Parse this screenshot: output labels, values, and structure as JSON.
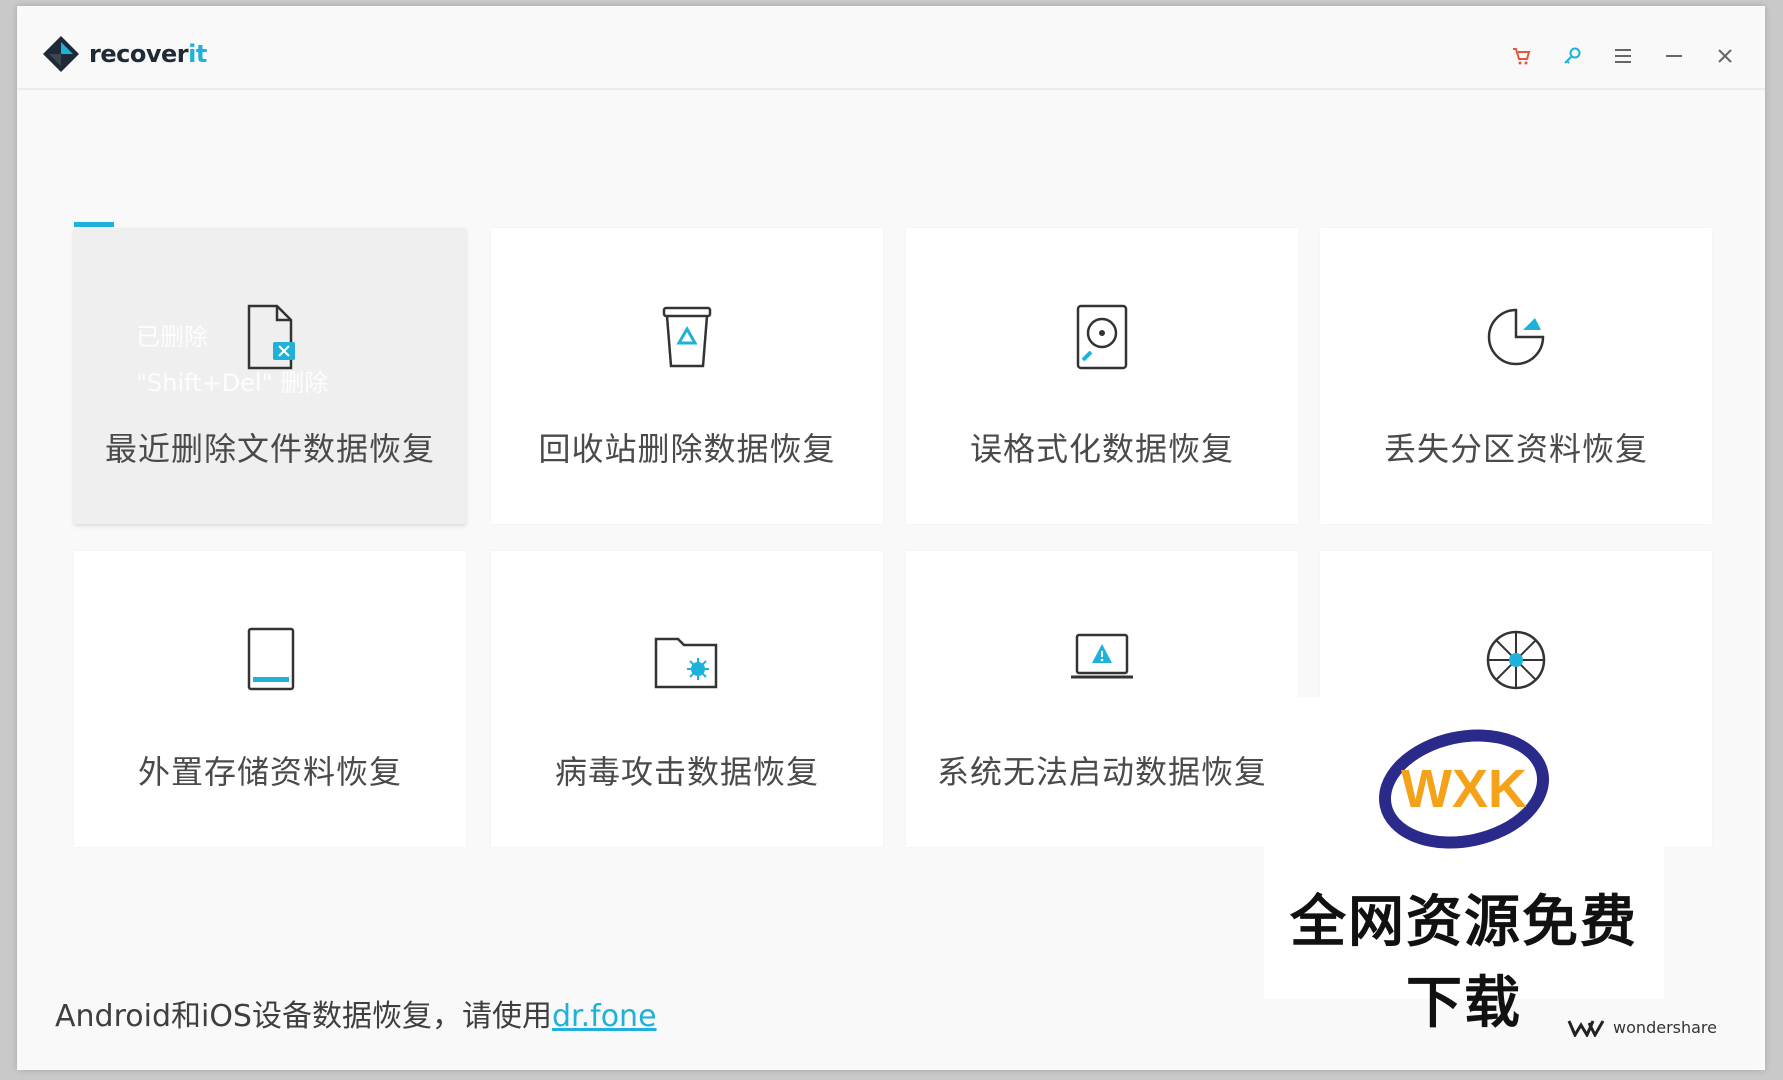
{
  "app": {
    "brand_main": "recover",
    "brand_accent": "it"
  },
  "title_controls": [
    {
      "name": "cart-icon",
      "color": "#e8543a"
    },
    {
      "name": "key-icon",
      "color": "#1eb2da"
    },
    {
      "name": "menu-icon",
      "color": "#666666"
    },
    {
      "name": "minimize-icon",
      "color": "#666666"
    },
    {
      "name": "close-icon",
      "color": "#666666"
    }
  ],
  "tiles": [
    {
      "label": "最近删除文件数据恢复",
      "icon": "deleted-file-icon",
      "selected": true,
      "hint": [
        "已删除",
        "\"Shift+Del\" 删除"
      ]
    },
    {
      "label": "回收站删除数据恢复",
      "icon": "recycle-bin-icon"
    },
    {
      "label": "误格式化数据恢复",
      "icon": "formatted-disk-icon"
    },
    {
      "label": "丢失分区资料恢复",
      "icon": "lost-partition-icon"
    },
    {
      "label": "外置存储资料恢复",
      "icon": "external-device-icon"
    },
    {
      "label": "病毒攻击数据恢复",
      "icon": "virus-folder-icon"
    },
    {
      "label": "系统无法启动数据恢复",
      "icon": "system-crash-icon"
    },
    {
      "label": "",
      "icon": "all-around-recovery-icon"
    }
  ],
  "footer": {
    "text": "Android和iOS设备数据恢复，请使用",
    "link": "dr.fone",
    "vendor": "wondershare"
  },
  "watermark": {
    "logo_text": "WXK",
    "caption": "全网资源免费下载"
  },
  "colors": {
    "accent": "#1eb2da",
    "tile_bg": "#ffffff",
    "selected_tile_bg": "#efefef"
  }
}
